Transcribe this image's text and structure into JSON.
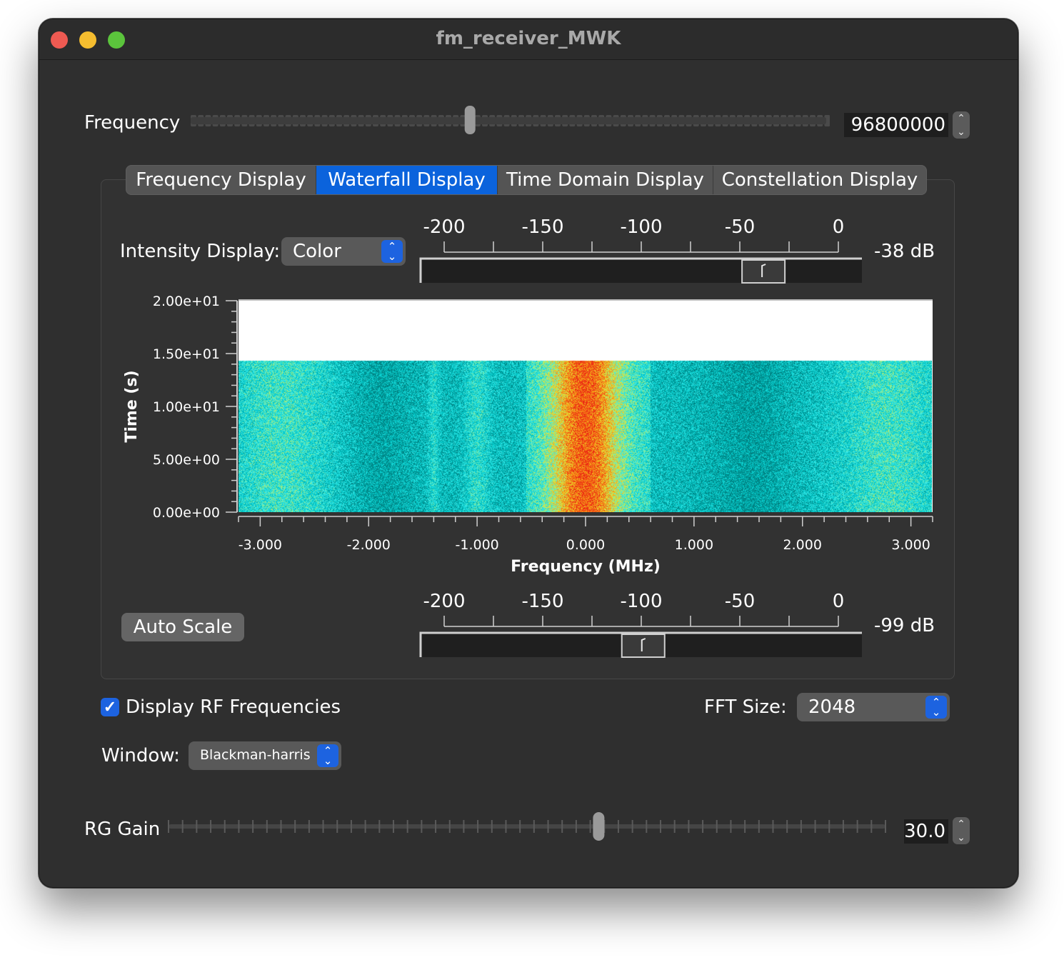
{
  "window": {
    "title": "fm_receiver_MWK"
  },
  "frequency": {
    "label": "Frequency",
    "value": "96800000",
    "slider_fraction": 0.439
  },
  "tabs": [
    {
      "label": "Frequency Display",
      "active": false
    },
    {
      "label": "Waterfall Display",
      "active": true
    },
    {
      "label": "Time Domain Display",
      "active": false
    },
    {
      "label": "Constellation Display",
      "active": false
    }
  ],
  "intensity": {
    "label": "Intensity Display:",
    "value": "Color"
  },
  "top_slider": {
    "ticks": [
      "-200",
      "-150",
      "-100",
      "-50",
      "0"
    ],
    "value_label": "-38 dB",
    "value": -38
  },
  "bottom_slider": {
    "ticks": [
      "-200",
      "-150",
      "-100",
      "-50",
      "0"
    ],
    "value_label": "-99 dB",
    "value": -99
  },
  "auto_scale_label": "Auto Scale",
  "chart_data": {
    "type": "heatmap",
    "xlabel": "Frequency (MHz)",
    "ylabel": "Time (s)",
    "x_ticks": [
      "-3.000",
      "-2.000",
      "-1.000",
      "0.000",
      "1.000",
      "2.000",
      "3.000"
    ],
    "y_ticks": [
      "0.00e+00",
      "5.00e+00",
      "1.00e+01",
      "1.50e+01",
      "2.00e+01"
    ],
    "xlim": [
      -3.2,
      3.2
    ],
    "ylim": [
      0,
      20
    ],
    "filled_time_range": [
      0,
      14.3
    ],
    "colormap": "color",
    "peak_center_mhz": 0.0,
    "strong_band_mhz": [
      -0.55,
      0.6
    ]
  },
  "display_rf": {
    "label": "Display RF Frequencies",
    "checked": true
  },
  "fft": {
    "label": "FFT Size:",
    "value": "2048"
  },
  "window_fn": {
    "label": "Window:",
    "value": "Blackman-harris"
  },
  "rg_gain": {
    "label": "RG Gain",
    "value": "30.0",
    "slider_fraction": 0.6
  },
  "colors": {
    "accent": "#0b63dc",
    "window_bg": "#2f2f2f"
  }
}
